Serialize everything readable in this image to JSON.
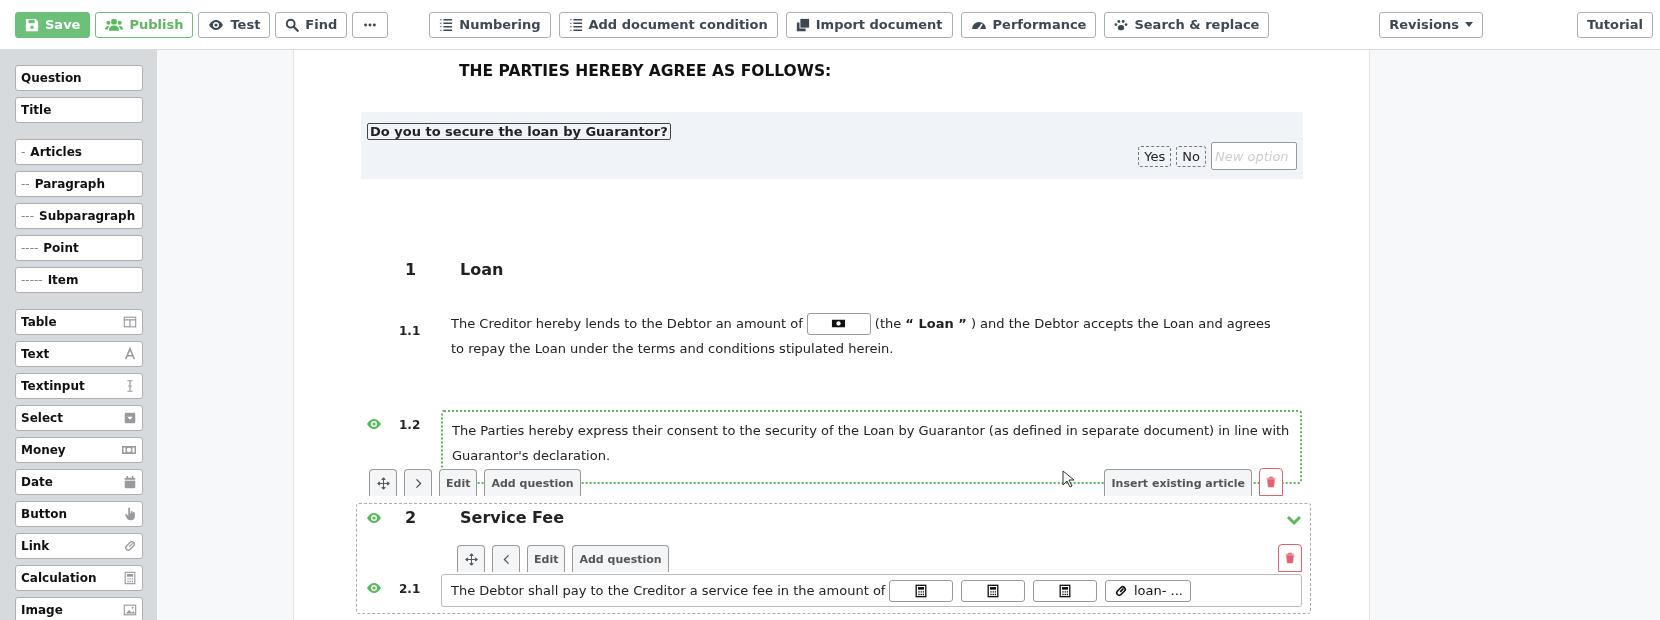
{
  "toolbar": {
    "left": [
      {
        "label": "Save",
        "kind": "primary"
      },
      {
        "label": "Publish",
        "kind": "accent"
      },
      {
        "label": "Test",
        "kind": "default"
      },
      {
        "label": "Find",
        "kind": "default"
      },
      {
        "kind": "more"
      }
    ],
    "middle": [
      {
        "label": "Numbering",
        "kind": "default"
      },
      {
        "label": "Add document condition",
        "kind": "default"
      },
      {
        "label": "Import document",
        "kind": "default"
      },
      {
        "label": "Performance",
        "kind": "default"
      },
      {
        "label": "Search & replace",
        "kind": "default"
      }
    ],
    "revisions": "Revisions",
    "tutorial": "Tutorial"
  },
  "sidebar": {
    "groups": [
      [
        {
          "label": "Question"
        },
        {
          "label": "Title"
        }
      ],
      [
        {
          "prefix": "-",
          "label": "Articles"
        },
        {
          "prefix": "--",
          "label": "Paragraph"
        },
        {
          "prefix": "---",
          "label": "Subparagraph"
        },
        {
          "prefix": "----",
          "label": "Point"
        },
        {
          "prefix": "-----",
          "label": "Item"
        }
      ],
      [
        {
          "label": "Table"
        },
        {
          "label": "Text"
        },
        {
          "label": "Textinput"
        },
        {
          "label": "Select"
        },
        {
          "label": "Money"
        },
        {
          "label": "Date"
        },
        {
          "label": "Button"
        },
        {
          "label": "Link"
        },
        {
          "label": "Calculation"
        },
        {
          "label": "Image"
        }
      ]
    ]
  },
  "document": {
    "heading": "THE PARTIES HEREBY AGREE AS FOLLOWS:",
    "question": {
      "text": "Do you to secure the loan by Guarantor?",
      "options": [
        "Yes",
        "No"
      ],
      "new_option_placeholder": "New option"
    },
    "sections": [
      {
        "number": "1",
        "title": "Loan",
        "eye": false,
        "paragraphs": [
          {
            "number": "1.1",
            "eye": false,
            "highlighted": false,
            "lines": [
              [
                {
                  "kind": "text",
                  "text": "The Creditor hereby lends to the Debtor an amount of"
                },
                {
                  "kind": "money"
                },
                {
                  "kind": "text",
                  "text": "(the **“ Loan ”** ) and the Debtor accepts the Loan and agrees"
                }
              ],
              [
                {
                  "kind": "text",
                  "text": "to repay the Loan under the terms and conditions stipulated herein."
                }
              ]
            ]
          },
          {
            "number": "1.2",
            "eye": true,
            "highlighted": true,
            "lines": [
              [
                {
                  "kind": "text",
                  "text": "The Parties hereby express their consent to the security of the Loan by Guarantor (as defined in separate document) in line with Guarantor's declaration."
                }
              ]
            ],
            "controls": [
              {
                "kind": "move"
              },
              {
                "kind": "indent"
              },
              {
                "kind": "label",
                "label": "Edit"
              },
              {
                "kind": "label",
                "label": "Add question"
              }
            ],
            "insert": "Insert existing article"
          }
        ]
      },
      {
        "number": "2",
        "title": "Service Fee",
        "eye": true,
        "expanded": true,
        "controls": [
          {
            "kind": "move"
          },
          {
            "kind": "outdent"
          },
          {
            "kind": "label",
            "label": "Edit"
          },
          {
            "kind": "label",
            "label": "Add question"
          }
        ],
        "paragraphs": [
          {
            "number": "2.1",
            "eye": true,
            "highlighted": false,
            "lines": [
              [
                {
                  "kind": "text",
                  "text": "The Debtor shall pay to the Creditor a service fee in the amount of"
                },
                {
                  "kind": "calculation"
                },
                {
                  "kind": "calculation"
                },
                {
                  "kind": "calculation"
                },
                {
                  "kind": "link",
                  "value": "loan- ..."
                }
              ]
            ]
          }
        ]
      }
    ]
  }
}
